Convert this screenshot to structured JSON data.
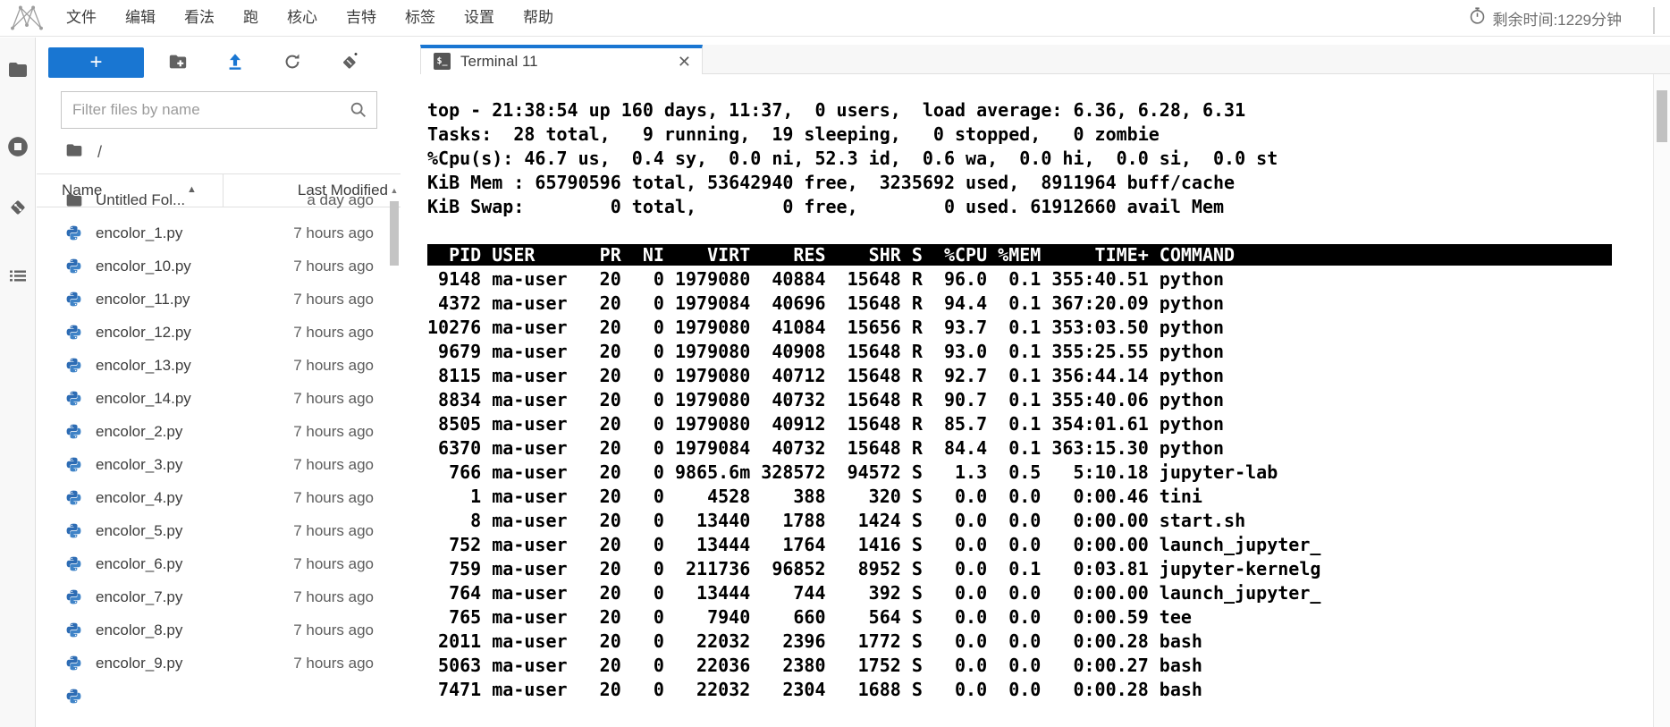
{
  "menu_bar": {
    "items": [
      "文件",
      "编辑",
      "看法",
      "跑",
      "核心",
      "吉特",
      "标签",
      "设置",
      "帮助"
    ],
    "remaining_time": "剩余时间:1229分钟"
  },
  "activity_bar": {
    "icons": [
      "file-browser",
      "running-sessions",
      "git",
      "table-of-contents"
    ]
  },
  "file_browser": {
    "filter_placeholder": "Filter files by name",
    "breadcrumb_root": "/",
    "columns": {
      "name": "Name",
      "last_modified": "Last Modified"
    },
    "files": [
      {
        "name": "Untitled Fol...",
        "modified": "a day ago",
        "type": "folder"
      },
      {
        "name": "encolor_1.py",
        "modified": "7 hours ago",
        "type": "python"
      },
      {
        "name": "encolor_10.py",
        "modified": "7 hours ago",
        "type": "python"
      },
      {
        "name": "encolor_11.py",
        "modified": "7 hours ago",
        "type": "python"
      },
      {
        "name": "encolor_12.py",
        "modified": "7 hours ago",
        "type": "python"
      },
      {
        "name": "encolor_13.py",
        "modified": "7 hours ago",
        "type": "python"
      },
      {
        "name": "encolor_14.py",
        "modified": "7 hours ago",
        "type": "python"
      },
      {
        "name": "encolor_2.py",
        "modified": "7 hours ago",
        "type": "python"
      },
      {
        "name": "encolor_3.py",
        "modified": "7 hours ago",
        "type": "python"
      },
      {
        "name": "encolor_4.py",
        "modified": "7 hours ago",
        "type": "python"
      },
      {
        "name": "encolor_5.py",
        "modified": "7 hours ago",
        "type": "python"
      },
      {
        "name": "encolor_6.py",
        "modified": "7 hours ago",
        "type": "python"
      },
      {
        "name": "encolor_7.py",
        "modified": "7 hours ago",
        "type": "python"
      },
      {
        "name": "encolor_8.py",
        "modified": "7 hours ago",
        "type": "python"
      },
      {
        "name": "encolor_9.py",
        "modified": "7 hours ago",
        "type": "python"
      },
      {
        "name": "",
        "modified": "",
        "type": "python"
      }
    ]
  },
  "tab": {
    "title": "Terminal 11"
  },
  "terminal": {
    "summary_lines": [
      "top - 21:38:54 up 160 days, 11:37,  0 users,  load average: 6.36, 6.28, 6.31",
      "Tasks:  28 total,   9 running,  19 sleeping,   0 stopped,   0 zombie",
      "%Cpu(s): 46.7 us,  0.4 sy,  0.0 ni, 52.3 id,  0.6 wa,  0.0 hi,  0.0 si,  0.0 st",
      "KiB Mem : 65790596 total, 53642940 free,  3235692 used,  8911964 buff/cache",
      "KiB Swap:        0 total,        0 free,        0 used. 61912660 avail Mem"
    ],
    "columns_header": "  PID USER      PR  NI    VIRT    RES    SHR S  %CPU %MEM     TIME+ COMMAND",
    "process_lines": [
      " 9148 ma-user   20   0 1979080  40884  15648 R  96.0  0.1 355:40.51 python",
      " 4372 ma-user   20   0 1979084  40696  15648 R  94.4  0.1 367:20.09 python",
      "10276 ma-user   20   0 1979080  41084  15656 R  93.7  0.1 353:03.50 python",
      " 9679 ma-user   20   0 1979080  40908  15648 R  93.0  0.1 355:25.55 python",
      " 8115 ma-user   20   0 1979080  40712  15648 R  92.7  0.1 356:44.14 python",
      " 8834 ma-user   20   0 1979080  40732  15648 R  90.7  0.1 355:40.06 python",
      " 8505 ma-user   20   0 1979080  40912  15648 R  85.7  0.1 354:01.61 python",
      " 6370 ma-user   20   0 1979084  40732  15648 R  84.4  0.1 363:15.30 python",
      "  766 ma-user   20   0 9865.6m 328572  94572 S   1.3  0.5   5:10.18 jupyter-lab",
      "    1 ma-user   20   0    4528    388    320 S   0.0  0.0   0:00.46 tini",
      "    8 ma-user   20   0   13440   1788   1424 S   0.0  0.0   0:00.00 start.sh",
      "  752 ma-user   20   0   13444   1764   1416 S   0.0  0.0   0:00.00 launch_jupyter_",
      "  759 ma-user   20   0  211736  96852   8952 S   0.0  0.1   0:03.81 jupyter-kernelg",
      "  764 ma-user   20   0   13444    744    392 S   0.0  0.0   0:00.00 launch_jupyter_",
      "  765 ma-user   20   0    7940    660    564 S   0.0  0.0   0:00.59 tee",
      " 2011 ma-user   20   0   22032   2396   1772 S   0.0  0.0   0:00.28 bash",
      " 5063 ma-user   20   0   22036   2380   1752 S   0.0  0.0   0:00.27 bash",
      " 7471 ma-user   20   0   22032   2304   1688 S   0.0  0.0   0:00.28 bash"
    ]
  },
  "colors": {
    "accent": "#1976d2",
    "table_header_bg": "#000000",
    "table_header_fg": "#ffffff",
    "icon_gray": "#616161"
  }
}
